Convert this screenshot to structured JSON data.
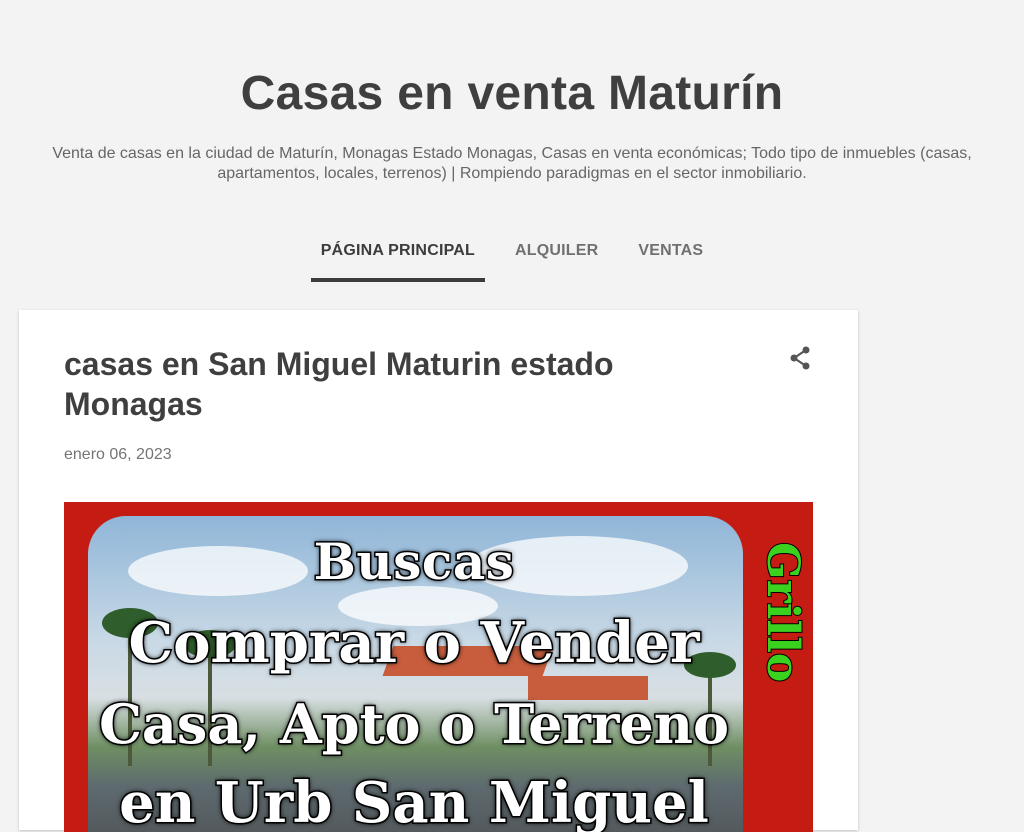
{
  "header": {
    "title": "Casas en venta Maturín",
    "description": "Venta de casas en la ciudad de Maturín, Monagas Estado Monagas, Casas en venta económicas; Todo tipo de inmuebles (casas, apartamentos, locales, terrenos) | Rompiendo paradigmas en el sector inmobiliario."
  },
  "nav": {
    "tabs": [
      {
        "label": "PÁGINA PRINCIPAL",
        "active": true
      },
      {
        "label": "ALQUILER",
        "active": false
      },
      {
        "label": "VENTAS",
        "active": false
      }
    ]
  },
  "post": {
    "title": "casas en San Miguel Maturin estado Monagas",
    "date": "enero 06, 2023",
    "share_icon": "share-icon",
    "image": {
      "lines": [
        "Buscas",
        "Comprar o Vender",
        "Casa, Apto o Terreno",
        "en Urb San Miguel"
      ],
      "side_text": "Grillo",
      "frame_color": "#c41c12",
      "side_text_color": "#3bd11f"
    }
  }
}
